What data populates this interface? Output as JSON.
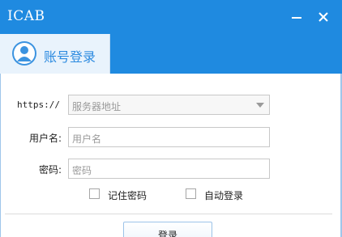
{
  "window": {
    "title": "ICAB",
    "minimize_icon": "minimize-icon",
    "close_icon": "close-icon"
  },
  "tab": {
    "label": "账号登录",
    "icon": "user-avatar-icon"
  },
  "form": {
    "server": {
      "label": "https://",
      "placeholder": "服务器地址"
    },
    "username": {
      "label": "用户名:",
      "placeholder": "用户名"
    },
    "password": {
      "label": "密码:",
      "placeholder": "密码"
    },
    "remember_password": {
      "label": "记住密码",
      "checked": false
    },
    "auto_login": {
      "label": "自动登录",
      "checked": false
    }
  },
  "actions": {
    "login_label": "登录"
  },
  "colors": {
    "title_bar": "#1f8ae0",
    "tab_active_bg": "#e9f3fc",
    "accent_text": "#2d8be0"
  }
}
